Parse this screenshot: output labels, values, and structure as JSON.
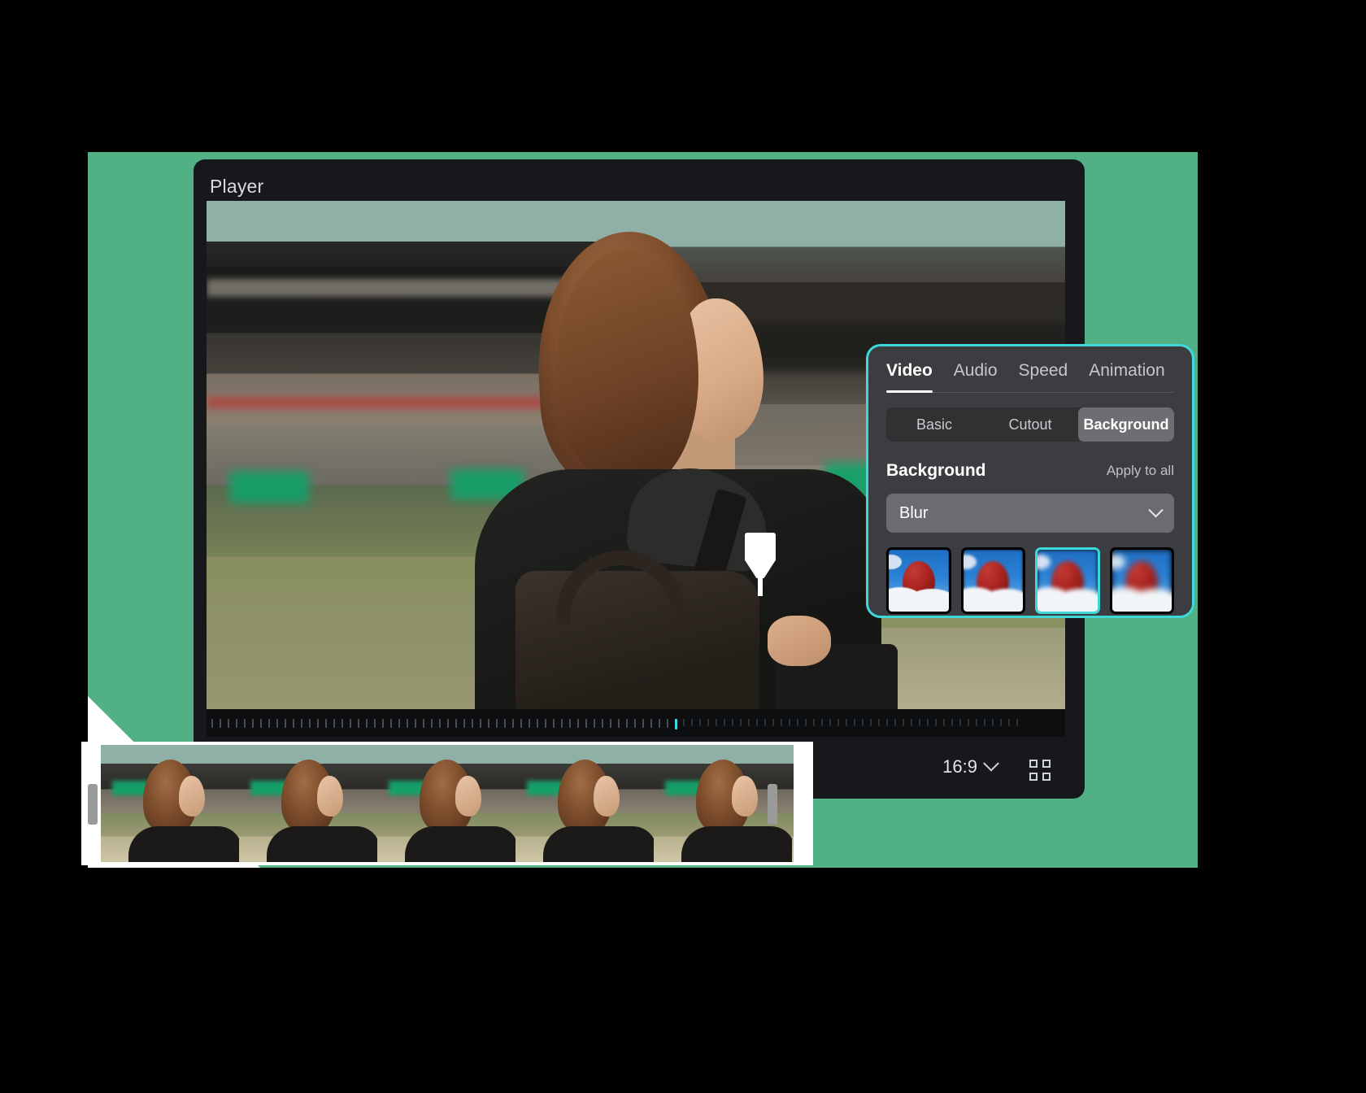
{
  "theme": {
    "brand_green": "#52b184",
    "accent_cyan": "#3fd8da",
    "panel_bg": "#3c3d40",
    "window_bg": "#16181c",
    "white": "#ffffff"
  },
  "app": {
    "player_title": "Player"
  },
  "player_bar": {
    "aspect_ratio": "16:9",
    "aspect_icon": "chevron-down-icon",
    "fullscreen_icon": "fullscreen-icon"
  },
  "timeline": {
    "playhead_icon": "playhead-marker",
    "trim_left_icon": "trim-handle-left",
    "trim_right_icon": "trim-handle-right",
    "tick_count": 100,
    "active_tick_index": 57
  },
  "settings_panel": {
    "tabs": [
      {
        "label": "Video",
        "active": true
      },
      {
        "label": "Audio",
        "active": false
      },
      {
        "label": "Speed",
        "active": false
      },
      {
        "label": "Animation",
        "active": false
      }
    ],
    "segments": [
      {
        "label": "Basic",
        "active": false
      },
      {
        "label": "Cutout",
        "active": false
      },
      {
        "label": "Background",
        "active": true
      }
    ],
    "section_title": "Background",
    "apply_to_all": "Apply to all",
    "dropdown": {
      "value": "Blur",
      "icon": "chevron-down-icon"
    },
    "thumbnails": [
      {
        "name": "blur-preset-1",
        "blur_level": 0,
        "selected": false
      },
      {
        "name": "blur-preset-2",
        "blur_level": 1,
        "selected": false
      },
      {
        "name": "blur-preset-3",
        "blur_level": 2,
        "selected": true
      },
      {
        "name": "blur-preset-4",
        "blur_level": 3,
        "selected": false
      }
    ]
  }
}
